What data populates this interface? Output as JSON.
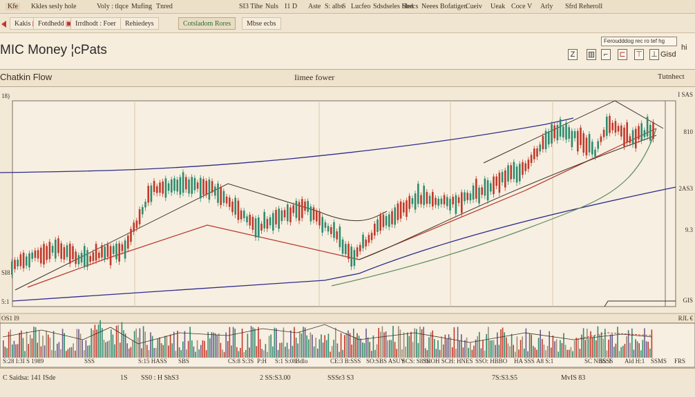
{
  "topbar": {
    "items": [
      "Kfe",
      "Kkles sesly hole",
      "Voly : tlqce",
      "Mufing",
      "Tnred",
      "SI3 Tihe",
      "Nuls",
      "I1 D",
      "Aste",
      "S: albs",
      "S",
      "Lucfeo",
      "Sdsdseles Hed",
      "Sbecs",
      "Neees Bofatigen",
      "Cueiv",
      "Ueak",
      "Coce",
      "V",
      "Arly",
      "Sfrd Reheroll"
    ]
  },
  "tabs": [
    {
      "label": "Kakis",
      "closable": true
    },
    {
      "label": "Fotdhedd",
      "closable": true
    },
    {
      "label": "Irrdhodt : Foer",
      "closable": false
    },
    {
      "label": "Rehiedeys",
      "closable": false
    },
    {
      "label": "Cotsladom Rores",
      "closable": false,
      "active": true
    },
    {
      "label": "Mbse ecbs",
      "closable": false
    }
  ],
  "header": {
    "title": "MIC Money ¦cPats",
    "search": "Feroudddog rec ro tef hg",
    "tool_icons": [
      "z-icon",
      "bar-chart-icon",
      "cursor-icon",
      "flag-icon",
      "line-icon",
      "candle-icon"
    ],
    "tool_label": "Gisd",
    "tool_label2": "hi"
  },
  "section": {
    "left": "Chatkin Flow",
    "center": "Iimee fower",
    "right": "Tutnhect"
  },
  "price_axis": {
    "top_left": "18)",
    "top_right": "I  SAS",
    "right_labels": [
      "810",
      "2AS3",
      "9.3",
      "GIS"
    ],
    "left_labels": [
      "SI8",
      "5:1"
    ],
    "vol_top_left": "OS1 I9",
    "vol_top_right": "RJL €"
  },
  "volume_labels": [
    "S:28 I:3I S 1989",
    "SSS",
    "S:15 HASS",
    "SBS",
    "CS:8 S:3S",
    "P:H",
    "S:1  S:08",
    "Bdlo",
    "CE:3 B:SSS",
    "SO:SBS ASUY",
    "SCS: S83S",
    "SHOH SCH:  HNES",
    "SSO: HBBO",
    "HA SSS",
    "A8 S:1",
    "SC NBS: I",
    "5SSS",
    "Ald H:1",
    "SSMS",
    "FRS"
  ],
  "footer": {
    "items": [
      "C Saidsa: 141 ISde",
      "1S",
      "SS0 : H ShS3",
      "2 SS:S3.00",
      "SSSr3 S3",
      "7S:S3.S5",
      "MvIS 83"
    ]
  },
  "colors": {
    "background": "#f3e9d7",
    "bull": "#2e8b6e",
    "bear": "#c0392b",
    "navy_line": "#2c2a8a",
    "trend_red": "#b8322a",
    "trend_green": "#5b8b5f"
  }
}
